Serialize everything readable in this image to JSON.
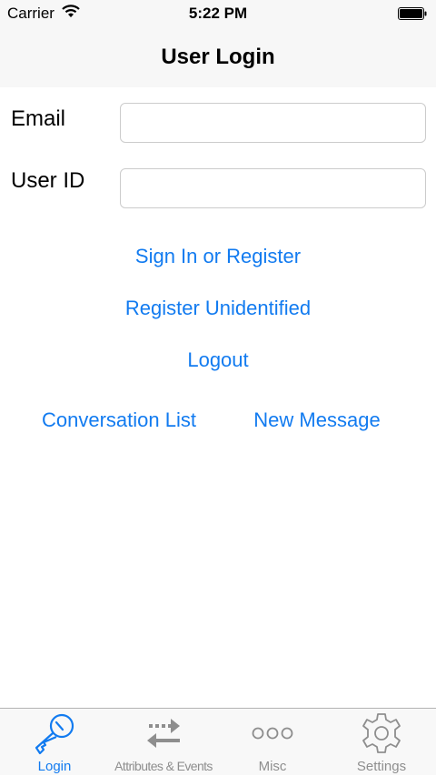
{
  "status_bar": {
    "carrier": "Carrier",
    "time": "5:22 PM",
    "icons": [
      "wifi-icon",
      "battery-icon"
    ]
  },
  "nav": {
    "title": "User Login"
  },
  "form": {
    "email_label": "Email",
    "email_value": "",
    "user_id_label": "User ID",
    "user_id_value": ""
  },
  "actions": {
    "sign_in": "Sign In or Register",
    "register_unidentified": "Register Unidentified",
    "logout": "Logout",
    "conversation_list": "Conversation List",
    "new_message": "New Message"
  },
  "tab_bar": {
    "tabs": [
      {
        "label": "Login",
        "icon": "key-icon",
        "active": true
      },
      {
        "label": "Attributes & Events",
        "icon": "arrows-exchange-icon",
        "active": false
      },
      {
        "label": "Misc",
        "icon": "more-dots-icon",
        "active": false
      },
      {
        "label": "Settings",
        "icon": "gear-icon",
        "active": false
      }
    ]
  },
  "colors": {
    "accent": "#127bf0",
    "inactive": "#8e8e8e",
    "bar_background": "#f7f7f7"
  }
}
